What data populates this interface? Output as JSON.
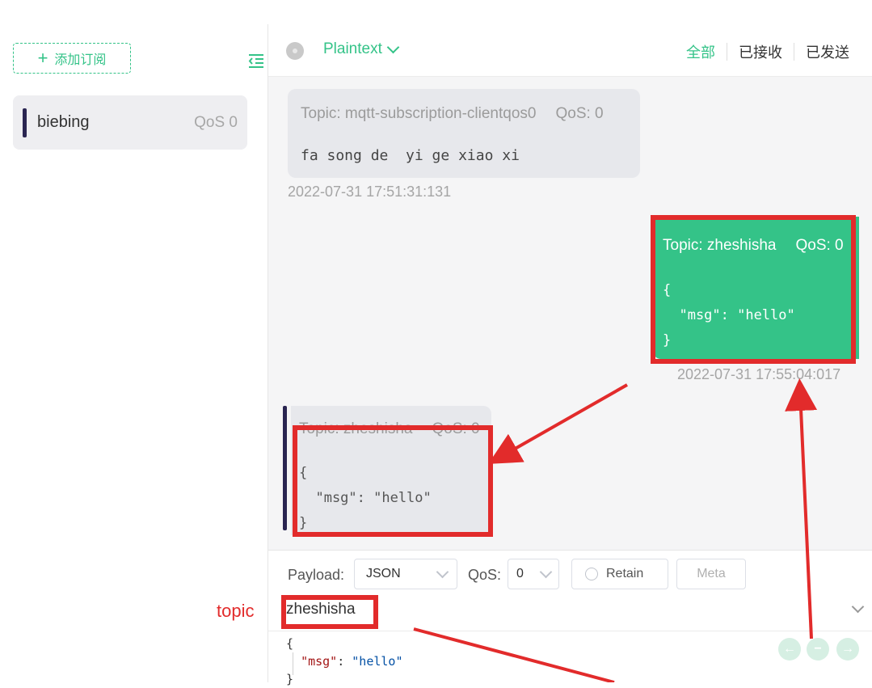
{
  "sidebar": {
    "add_subscription_label": "添加订阅",
    "subscriptions": [
      {
        "topic": "biebing",
        "qos": "QoS 0",
        "color": "#2a2551"
      }
    ]
  },
  "header": {
    "format": "Plaintext",
    "filters": [
      "全部",
      "已接收",
      "已发送"
    ],
    "active_filter": "全部"
  },
  "messages": [
    {
      "direction": "received",
      "topic": "Topic: mqtt-subscription-clientqos0",
      "qos": "QoS: 0",
      "payload": "fa song de  yi ge xiao xi",
      "time": "2022-07-31 17:51:31:131"
    },
    {
      "direction": "sent",
      "topic": "Topic: zheshisha",
      "qos": "QoS: 0",
      "payload": "{\n  \"msg\": \"hello\"\n}",
      "time": "2022-07-31 17:55:04:017"
    },
    {
      "direction": "received",
      "topic": "Topic: zheshisha",
      "qos": "QoS: 0",
      "payload": "{\n  \"msg\": \"hello\"\n}",
      "time": ""
    }
  ],
  "composer": {
    "payload_label": "Payload:",
    "payload_format": "JSON",
    "qos_label": "QoS:",
    "qos_value": "0",
    "retain_label": "Retain",
    "meta_label": "Meta",
    "topic": "zheshisha",
    "code_open": "{",
    "code_key": "\"msg\"",
    "code_colon": ": ",
    "code_value": "\"hello\"",
    "code_close": "}"
  },
  "annotation": {
    "topic_label": "topic",
    "color": "#e22b2b"
  },
  "colors": {
    "accent": "#34c388",
    "subscription_bar": "#2a2551"
  }
}
